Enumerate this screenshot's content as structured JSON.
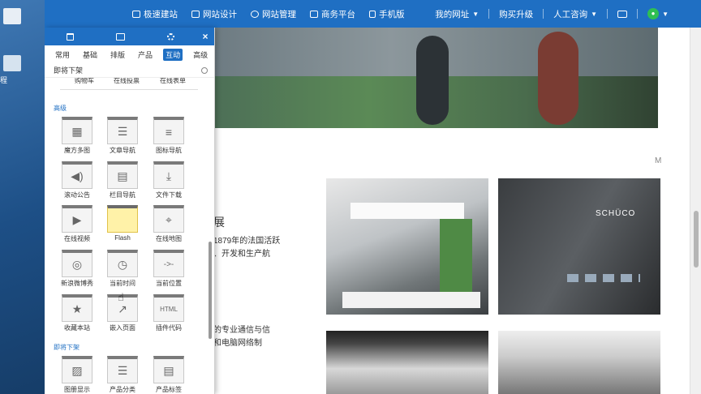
{
  "topbar": {
    "left_items": [
      {
        "label": "极速建站",
        "icon": "lightning-icon"
      },
      {
        "label": "网站设计",
        "icon": "monitor-icon"
      },
      {
        "label": "网站管理",
        "icon": "gear-icon"
      },
      {
        "label": "商务平台",
        "icon": "home-icon"
      },
      {
        "label": "手机版",
        "icon": "mobile-icon"
      }
    ],
    "my_site": "我的网址",
    "buy": "购买升级",
    "service": "人工咨询"
  },
  "desktop": {
    "label": "程"
  },
  "panel": {
    "subtabs": [
      "常用",
      "基础",
      "排版",
      "产品",
      "互动",
      "高级"
    ],
    "active_subtab": "互动",
    "search_placeholder": "即将下架",
    "top_row": [
      "购物车",
      "在线投票",
      "在线表单"
    ],
    "section_advanced": "高级",
    "tiles": [
      {
        "label": "魔方多图",
        "icon": "grid-icon"
      },
      {
        "label": "文章导航",
        "icon": "article-icon"
      },
      {
        "label": "图标导航",
        "icon": "list-icon"
      },
      {
        "label": "滚动公告",
        "icon": "speaker-icon"
      },
      {
        "label": "栏目导航",
        "icon": "column-icon"
      },
      {
        "label": "文件下载",
        "icon": "download-icon"
      },
      {
        "label": "在线视频",
        "icon": "play-icon"
      },
      {
        "label": "Flash",
        "icon": "flash-icon"
      },
      {
        "label": "在线地图",
        "icon": "map-pin-icon"
      },
      {
        "label": "新浪微博秀",
        "icon": "weibo-icon"
      },
      {
        "label": "当前时间",
        "icon": "clock-icon"
      },
      {
        "label": "当前位置",
        "icon": "location-icon"
      },
      {
        "label": "收藏本站",
        "icon": "star-icon"
      },
      {
        "label": "嵌入页面",
        "icon": "share-icon"
      },
      {
        "label": "插件代码",
        "icon": "html-icon"
      }
    ],
    "section_soon": "即将下架",
    "bottom_row": [
      "图册显示",
      "产品分类",
      "产品标签"
    ]
  },
  "content": {
    "heading_char": "展",
    "line1": "1879年的法国活跃",
    "line2": "、开发和生产航",
    "line3": "的专业通信与信",
    "line4": "和电脑网络制",
    "m_letter": "M",
    "brand": "SCHÜCO"
  }
}
